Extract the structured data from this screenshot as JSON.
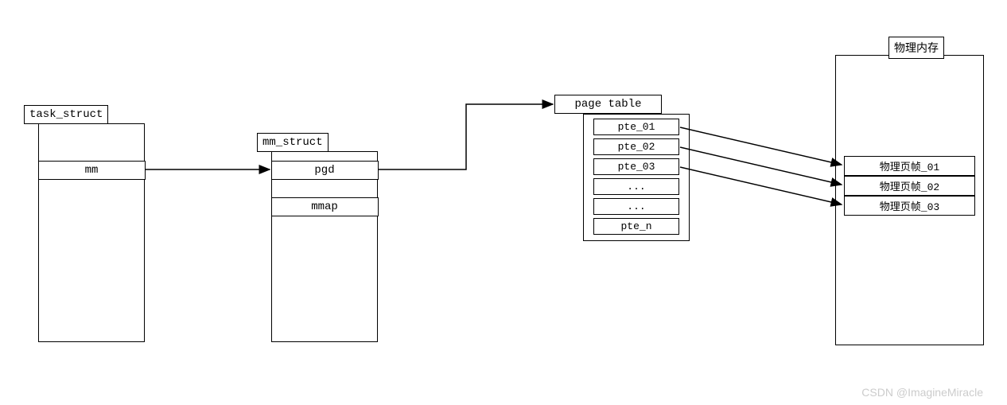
{
  "task_struct": {
    "title": "task_struct",
    "fields": {
      "mm": "mm"
    }
  },
  "mm_struct": {
    "title": "mm_struct",
    "fields": {
      "pgd": "pgd",
      "mmap": "mmap"
    }
  },
  "page_table": {
    "title": "page table",
    "entries": {
      "e0": "pte_01",
      "e1": "pte_02",
      "e2": "pte_03",
      "e3": "...",
      "e4": "...",
      "e5": "pte_n"
    }
  },
  "phys_mem": {
    "title": "物理内存",
    "frames": {
      "f0": "物理页帧_01",
      "f1": "物理页帧_02",
      "f2": "物理页帧_03"
    }
  },
  "watermark": "CSDN @ImagineMiracle"
}
